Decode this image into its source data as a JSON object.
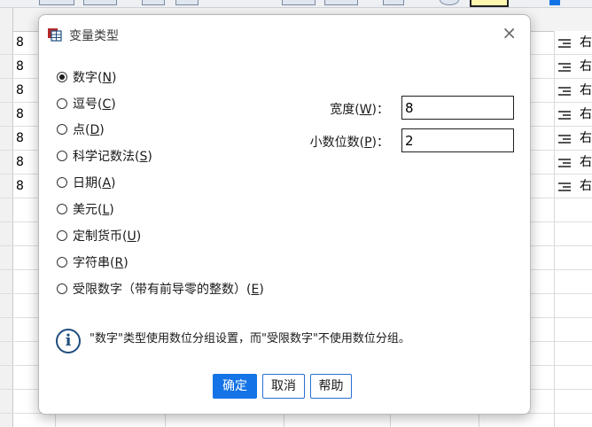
{
  "background": {
    "cell_values": [
      "8",
      "8",
      "8",
      "8",
      "8",
      "8",
      "8"
    ],
    "align_label": "右"
  },
  "dialog": {
    "title": "变量类型",
    "close_glyph": "×",
    "types": [
      {
        "prefix": "数字(",
        "mnemonic": "N",
        "suffix": ")",
        "selected": true
      },
      {
        "prefix": "逗号(",
        "mnemonic": "C",
        "suffix": ")",
        "selected": false
      },
      {
        "prefix": "点(",
        "mnemonic": "D",
        "suffix": ")",
        "selected": false
      },
      {
        "prefix": "科学记数法(",
        "mnemonic": "S",
        "suffix": ")",
        "selected": false
      },
      {
        "prefix": "日期(",
        "mnemonic": "A",
        "suffix": ")",
        "selected": false
      },
      {
        "prefix": "美元(",
        "mnemonic": "L",
        "suffix": ")",
        "selected": false
      },
      {
        "prefix": "定制货币(",
        "mnemonic": "U",
        "suffix": ")",
        "selected": false
      },
      {
        "prefix": "字符串(",
        "mnemonic": "R",
        "suffix": ")",
        "selected": false
      },
      {
        "prefix": "受限数字（带有前导零的整数）(",
        "mnemonic": "E",
        "suffix": ")",
        "selected": false
      }
    ],
    "width": {
      "prefix": "宽度(",
      "mnemonic": "W",
      "suffix": ")：",
      "value": "8"
    },
    "decimals": {
      "prefix": "小数位数(",
      "mnemonic": "P",
      "suffix": ")：",
      "value": "2"
    },
    "info": "\"数字\"类型使用数位分组设置，而\"受限数字\"不使用数位分组。",
    "buttons": {
      "ok": "确定",
      "cancel": "取消",
      "help": "帮助"
    },
    "colors": {
      "primary": "#1473e6",
      "info_icon": "#1f4f80"
    }
  }
}
